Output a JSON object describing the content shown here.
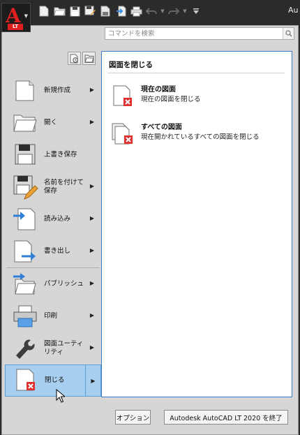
{
  "titlebar": {
    "app_menu_icon": "autocad-lt-logo",
    "app_logo_text": "A",
    "app_logo_badge": "LT",
    "title_fragment": "Au",
    "qat_icons": [
      "new-icon",
      "open-icon",
      "save-icon",
      "save-as-icon",
      "open-sheet-icon",
      "import-icon",
      "print-icon",
      "undo-icon",
      "redo-icon",
      "customize-icon"
    ]
  },
  "search": {
    "placeholder": "コマンドを検索",
    "value": ""
  },
  "commands": [
    {
      "id": "new",
      "label": "新規作成",
      "icon": "new-doc-icon",
      "has_arrow": true
    },
    {
      "id": "open",
      "label": "開く",
      "icon": "open-folder-icon",
      "has_arrow": true
    },
    {
      "id": "save",
      "label": "上書き保存",
      "icon": "save-icon",
      "has_arrow": false
    },
    {
      "id": "saveas",
      "label": "名前を付けて保存",
      "icon": "save-as-icon",
      "has_arrow": true
    },
    {
      "id": "import",
      "label": "読み込み",
      "icon": "import-icon",
      "has_arrow": true
    },
    {
      "id": "export",
      "label": "書き出し",
      "icon": "export-icon",
      "has_arrow": true
    },
    {
      "id": "publish",
      "label": "パブリッシュ",
      "icon": "publish-icon",
      "has_arrow": true
    },
    {
      "id": "print",
      "label": "印刷",
      "icon": "print-icon",
      "has_arrow": true
    },
    {
      "id": "utilities",
      "label": "図面ユーティリティ",
      "icon": "wrench-icon",
      "has_arrow": true
    },
    {
      "id": "close",
      "label": "閉じる",
      "icon": "close-doc-icon",
      "has_arrow": true,
      "active": true
    }
  ],
  "panel": {
    "title": "図面を閉じる",
    "items": [
      {
        "title": "現在の図面",
        "desc": "現在の図面を閉じる",
        "icon": "close-current-icon"
      },
      {
        "title": "すべての図面",
        "desc": "現在開かれているすべての図面を閉じる",
        "icon": "close-all-icon"
      }
    ]
  },
  "buttons": {
    "options": "オプション",
    "exit": "Autodesk AutoCAD LT 2020 を終了"
  },
  "colors": {
    "accent_red": "#e02020",
    "arrow_blue": "#2f7fd6",
    "active_bg": "#a9cff0",
    "panel_border": "#3c7dc8"
  }
}
